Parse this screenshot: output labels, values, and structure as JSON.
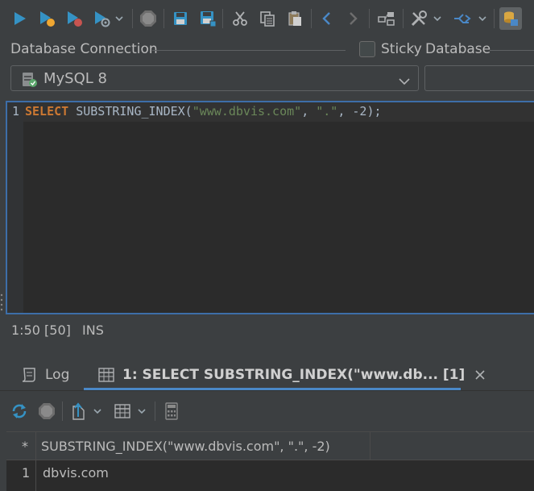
{
  "toolbar": {
    "icons": [
      "run-icon",
      "run-current-icon",
      "run-to-cursor-icon",
      "run-explain-icon",
      "stop-icon",
      "save-icon",
      "save-as-icon",
      "cut-icon",
      "copy-icon",
      "paste-icon",
      "back-icon",
      "forward-icon",
      "query-builder-icon",
      "tools-icon",
      "auto-commit-icon",
      "sql-commander-icon"
    ]
  },
  "connection": {
    "label": "Database Connection",
    "sticky_label": "Sticky",
    "database_label": "Database",
    "selected": "MySQL 8",
    "sticky_checked": false
  },
  "editor": {
    "line_number": "1",
    "keyword": "SELECT",
    "func": " SUBSTRING_INDEX(",
    "arg1": "\"www.dbvis.com\"",
    "sep1": ", ",
    "arg2": "\".\"",
    "rest": ", -2);"
  },
  "status": {
    "position": "1:50 [50]",
    "mode": "INS"
  },
  "tabs": [
    {
      "label": "Log",
      "selected": false
    },
    {
      "label": "1: SELECT SUBSTRING_INDEX(\"www.db... [1]",
      "selected": true
    }
  ],
  "grid": {
    "header_marker": "*",
    "columns": [
      "SUBSTRING_INDEX(\"www.dbvis.com\", \".\", -2)"
    ],
    "rows": [
      {
        "num": "1",
        "values": [
          "dbvis.com"
        ]
      }
    ]
  },
  "colors": {
    "accent": "#4a88c7",
    "keyword": "#cc7832",
    "string": "#6a8759",
    "run_blue": "#3592c4",
    "stop_red": "#c75450"
  }
}
